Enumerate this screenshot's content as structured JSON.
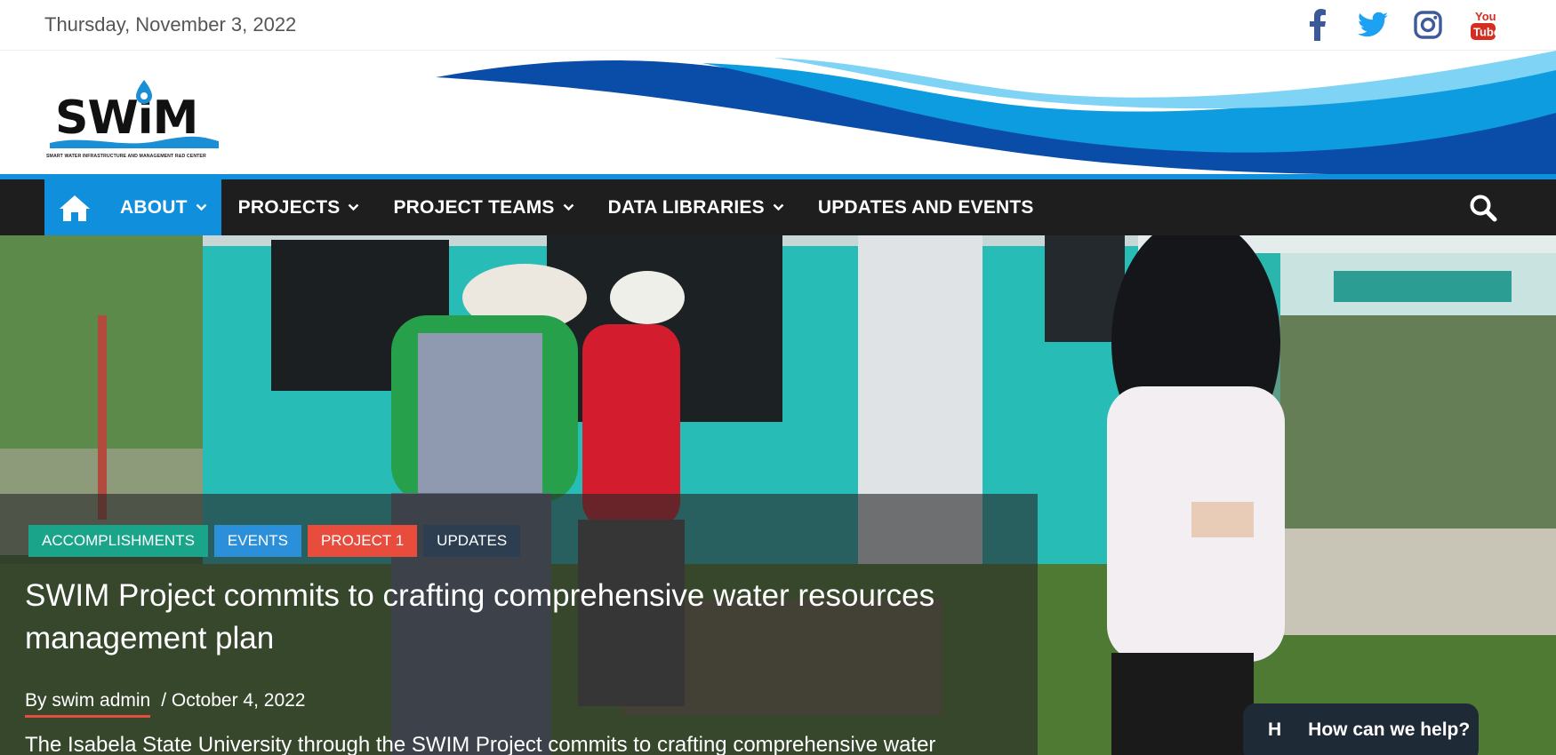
{
  "topbar": {
    "date": "Thursday, November 3, 2022",
    "social": [
      {
        "icon": "facebook-icon",
        "color": "#3b5998"
      },
      {
        "icon": "twitter-icon",
        "color": "#1da1f2"
      },
      {
        "icon": "instagram-icon",
        "color": "#3f5a9b"
      },
      {
        "icon": "youtube-icon",
        "color": "#d62d20"
      }
    ]
  },
  "header": {
    "logo_text": "SWiM",
    "logo_subtitle": "SMART WATER INFRASTRUCTURE AND MANAGEMENT R&D CENTER"
  },
  "nav": {
    "home_icon": "home-icon",
    "items": [
      {
        "label": "ABOUT",
        "has_dropdown": true,
        "active": true
      },
      {
        "label": "PROJECTS",
        "has_dropdown": true,
        "active": false
      },
      {
        "label": "PROJECT TEAMS",
        "has_dropdown": true,
        "active": false
      },
      {
        "label": "DATA LIBRARIES",
        "has_dropdown": true,
        "active": false
      },
      {
        "label": "UPDATES AND EVENTS",
        "has_dropdown": false,
        "active": false
      }
    ],
    "search_icon": "search-icon"
  },
  "hero": {
    "categories": [
      {
        "label": "ACCOMPLISHMENTS",
        "color": "#1aa58b"
      },
      {
        "label": "EVENTS",
        "color": "#2b8fd9"
      },
      {
        "label": "PROJECT 1",
        "color": "#e74c3c"
      },
      {
        "label": "UPDATES",
        "color": "#2c3e50"
      }
    ],
    "title": "SWIM Project commits to crafting comprehensive water resources management plan",
    "author_prefix": "By",
    "author": "swim admin",
    "date": "/ October 4, 2022",
    "excerpt": "The Isabela State University through the SWIM Project commits to crafting comprehensive water"
  },
  "help_widget": {
    "icon_letter": "H",
    "label": "How can we help?"
  },
  "colors": {
    "accent": "#0f8fdc",
    "nav_bg": "#1e1e1e"
  }
}
